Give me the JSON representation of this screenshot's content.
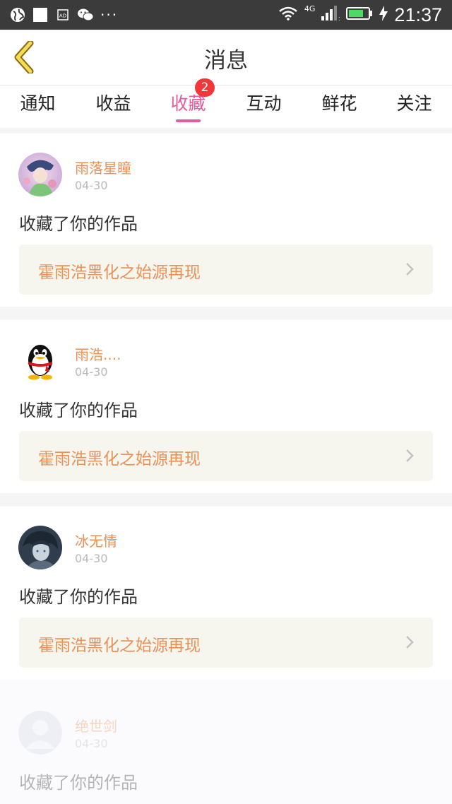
{
  "status_bar": {
    "time": "21:37",
    "network": "4G",
    "left_icons": [
      "globe-icon",
      "square-icon",
      "ad-icon",
      "wechat-icon"
    ],
    "overflow": "···"
  },
  "header": {
    "title": "消息"
  },
  "tabs": [
    {
      "label": "通知"
    },
    {
      "label": "收益"
    },
    {
      "label": "收藏",
      "badge": "2",
      "active": true
    },
    {
      "label": "互动"
    },
    {
      "label": "鲜花"
    },
    {
      "label": "关注"
    }
  ],
  "messages": [
    {
      "user": "雨落星瞳",
      "date": "04-30",
      "action": "收藏了你的作品",
      "work": "霍雨浩黑化之始源再现"
    },
    {
      "user": "雨浩....",
      "date": "04-30",
      "action": "收藏了你的作品",
      "work": "霍雨浩黑化之始源再现"
    },
    {
      "user": "冰无情",
      "date": "04-30",
      "action": "收藏了你的作品",
      "work": "霍雨浩黑化之始源再现"
    },
    {
      "user": "绝世剑",
      "date": "04-30",
      "action": "收藏了你的作品"
    }
  ],
  "colors": {
    "accent": "#e85a9d",
    "username": "#ea9158",
    "badge": "#f0383b"
  }
}
